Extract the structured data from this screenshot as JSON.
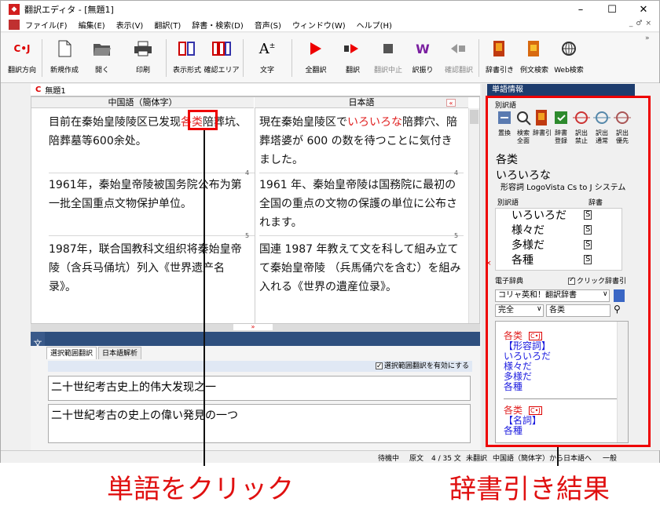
{
  "window": {
    "title": "翻訳エディタ - [無題1]",
    "controls": [
      "–",
      "☐",
      "✕"
    ]
  },
  "menu": {
    "items": [
      "ファイル(F)",
      "編集(E)",
      "表示(V)",
      "翻訳(T)",
      "辞書・検索(D)",
      "音声(S)",
      "ウィンドウ(W)",
      "ヘルプ(H)"
    ],
    "mdi_controls": [
      "_",
      "♂",
      "×"
    ]
  },
  "toolbar": {
    "direction": "翻訳方向",
    "new": "新規作成",
    "open": "開く",
    "print": "印刷",
    "display": "表示形式",
    "confirm_area": "確認エリア",
    "font": "文字",
    "translate_all": "全翻訳",
    "translate": "翻訳",
    "stop": "翻訳中止",
    "backtranslate": "訳振り",
    "check": "確認翻訳",
    "dict_lookup": "辞書引き",
    "example_search": "例文検索",
    "web_search": "Web検索",
    "overflow": "»"
  },
  "document": {
    "tab_badge": "C",
    "tab_name": "無題1",
    "source_header": "中国語（簡体字）",
    "target_header": "日本語",
    "segments": [
      {
        "num": "",
        "src_before": "目前在秦始皇陵陵区已发现",
        "src_highlight": "各类",
        "src_after": "陪葬坑、陪葬墓等600余处。",
        "tgt_before": "現在秦始皇陵区で",
        "tgt_highlight": "いろいろな",
        "tgt_after": "陪葬穴、陪葬塔婆が 600 の数を待つことに気付きました。"
      },
      {
        "num": "4",
        "src": "1961年，秦始皇帝陵被国务院公布为第一批全国重点文物保护单位。",
        "tgt": "1961 年、秦始皇帝陵は国務院に最初の全国の重点の文物の保護の単位に公布されます。"
      },
      {
        "num": "5",
        "src": "1987年，联合国教科文组织将秦始皇帝陵（含兵马俑坑）列入《世界遗产名录》。",
        "tgt": "国連 1987 年教えて文を科して組み立てて秦始皇帝陵 （兵馬俑穴を含む）を組み入れる《世界の遺産位录》。"
      }
    ]
  },
  "bottom_panel": {
    "side_label": "文情報",
    "tabs": [
      "選択範囲翻訳",
      "日本語解析"
    ],
    "enable_checkbox": "選択範囲翻訳を有効にする",
    "source_text": "二十世纪考古史上的伟大发现之一",
    "translated_text": "二十世紀考古の史上の偉い発見の一つ"
  },
  "word_panel": {
    "header": "単語情報",
    "section_alt": "別訳語",
    "tool_labels": [
      "置換",
      "検索\n全面",
      "辞書引",
      "辞書\n登録",
      "訳出\n禁止",
      "訳出\n通常",
      "訳出\n優先"
    ],
    "headword": "各类",
    "reading": "いろいろな",
    "pos_line": "形容詞  LogoVista Cs to J システム",
    "col_alt": "別訳語",
    "col_dict": "辞書",
    "alternatives": [
      {
        "word": "いろいろだ",
        "dict": "S"
      },
      {
        "word": "様々だ",
        "dict": "S"
      },
      {
        "word": "多様だ",
        "dict": "S"
      },
      {
        "word": "各種",
        "dict": "S"
      }
    ],
    "edict_label": "電子辞典",
    "click_dict": "クリック辞書引",
    "dict_select": "コリャ英和！翻訳辞書",
    "match_select": "完全",
    "search_value": "各类",
    "results": [
      {
        "head": "各类",
        "badge": "C•J",
        "pos": "【形容詞】",
        "words": [
          "いろいろだ",
          "様々だ",
          "多様だ",
          "各種"
        ]
      },
      {
        "head": "各类",
        "badge": "C•J",
        "pos": "【名詞】",
        "words": [
          "各種"
        ]
      }
    ]
  },
  "status": {
    "state": "待機中",
    "original": "原文",
    "position": "4 / 35 文",
    "untranslated": "未翻訳",
    "direction": "中国語（簡体字）から日本語へ",
    "mode": "一般"
  },
  "annotations": {
    "left_caption": "単語をクリック",
    "right_caption": "辞書引き結果"
  },
  "colors": {
    "accent_red": "#e00000",
    "panel_header": "#1e3d6e",
    "link_blue": "#1a1adf"
  }
}
